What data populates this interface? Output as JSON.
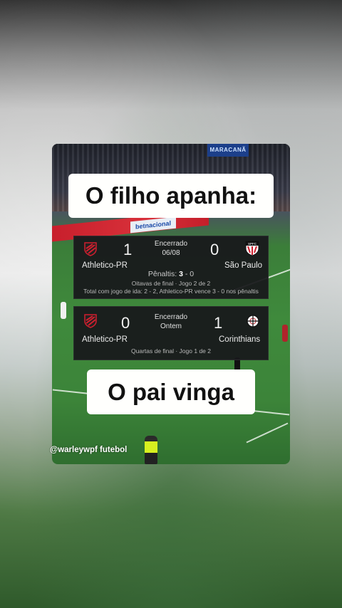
{
  "captions": {
    "top": "O filho apanha:",
    "bottom": "O pai vinga"
  },
  "stadium_sign": "MARACANÃ",
  "sponsor_board": "betnacional",
  "match1": {
    "home_team": "Athletico-PR",
    "home_score": "1",
    "away_team": "São Paulo",
    "away_score": "0",
    "status": "Encerrado",
    "date": "06/08",
    "penalties_label": "Pênaltis:",
    "penalties_home": "3",
    "penalties_sep": "-",
    "penalties_away": "0",
    "round": "Oitavas de final · Jogo 2 de 2",
    "aggregate": "Total com jogo de ida: 2 - 2, Athletico-PR vence 3 - 0 nos pênaltis"
  },
  "match2": {
    "home_team": "Athletico-PR",
    "home_score": "0",
    "away_team": "Corinthians",
    "away_score": "1",
    "status": "Encerrado",
    "date": "Ontem",
    "round": "Quartas de final · Jogo 1 de 2"
  },
  "watermark": "@warleywpf futebol",
  "colors": {
    "caption_bg": "#fffffd",
    "scoreboard_bg": "#18181c",
    "athletico_red": "#d01f2e",
    "pitch_green": "#3f8a3c"
  }
}
